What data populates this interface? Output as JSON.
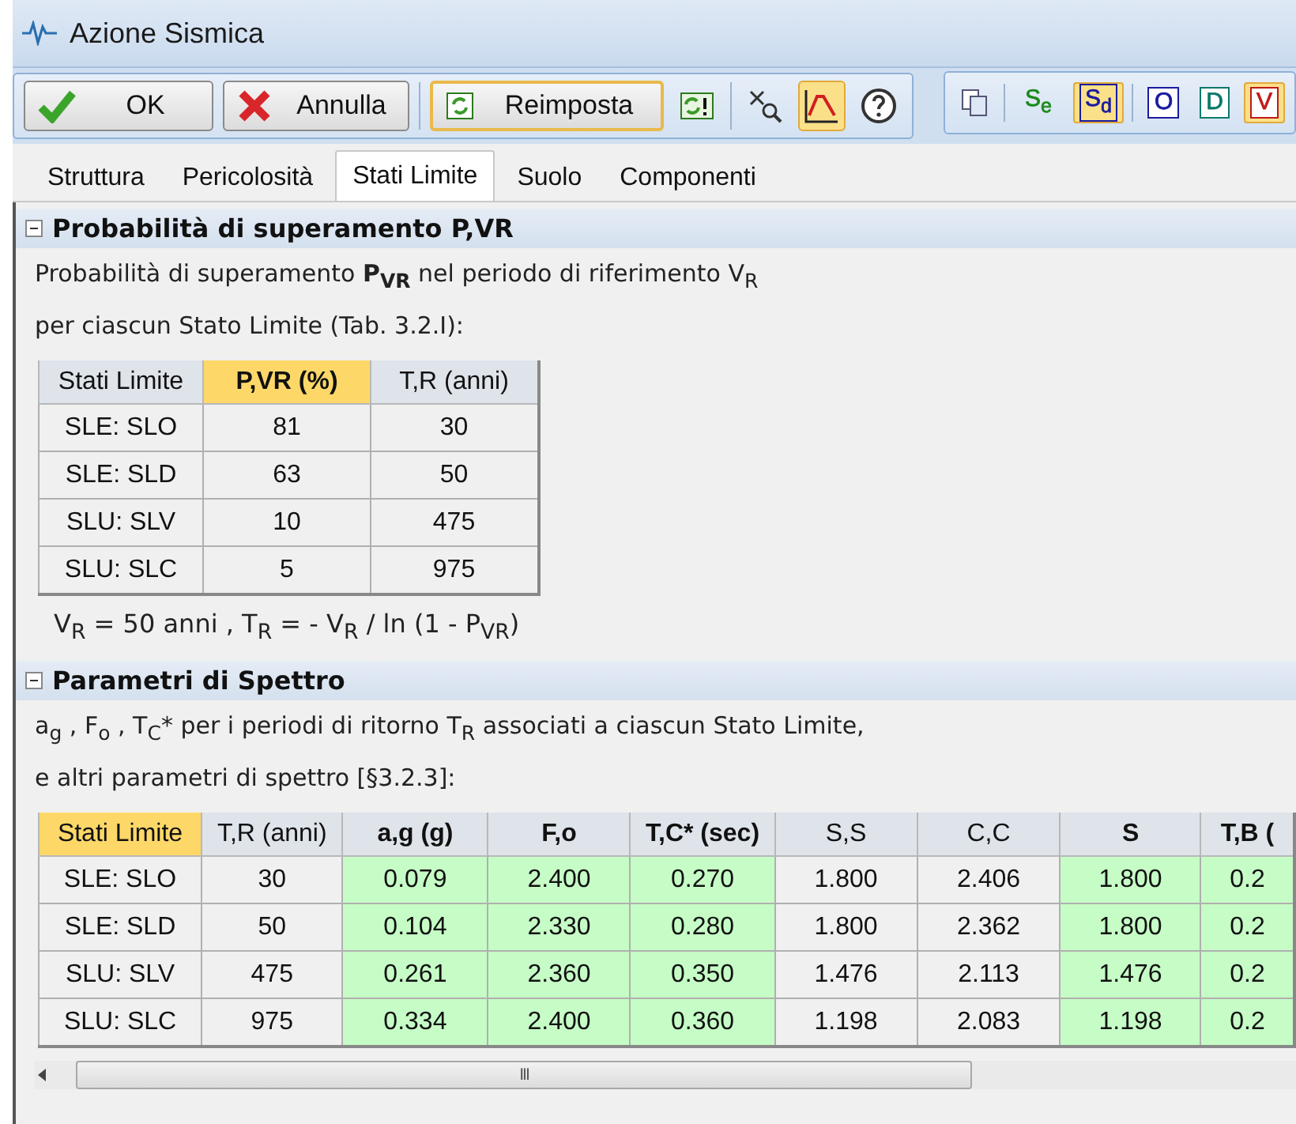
{
  "window": {
    "title": "Azione Sismica"
  },
  "toolbar": {
    "buttons": [
      {
        "kind": "ok",
        "label": "OK"
      },
      {
        "kind": "cancel",
        "label": "Annulla"
      },
      {
        "kind": "reset",
        "label": "Reimposta"
      }
    ],
    "tools": [
      {
        "kind": "refresh",
        "selected": false
      },
      {
        "kind": "zoom",
        "selected": false
      },
      {
        "kind": "chart",
        "selected": true
      },
      {
        "kind": "help",
        "selected": false
      }
    ],
    "toggles": [
      {
        "kind": "copy",
        "selected": false
      },
      {
        "kind": "letter",
        "label": "S$_{e}$",
        "selected": false,
        "color": "#1a8a1a"
      },
      {
        "kind": "letter",
        "label": "S$_{d}$",
        "selected": true,
        "color": "#1a1aa0"
      },
      {
        "kind": "letter",
        "label": "O",
        "selected": false,
        "color": "#1a1aa0"
      },
      {
        "kind": "letter",
        "label": "D",
        "selected": false,
        "color": "#0a7a6a"
      },
      {
        "kind": "letter",
        "label": "V",
        "selected": true,
        "color": "#c01818"
      }
    ]
  },
  "tabs": [
    {
      "label": "Struttura",
      "selected": false
    },
    {
      "label": "Pericolosità",
      "selected": false
    },
    {
      "label": "Stati Limite",
      "selected": true
    },
    {
      "label": "Suolo",
      "selected": false
    },
    {
      "label": "Componenti",
      "selected": false
    }
  ],
  "sections": [
    {
      "title": "Probabilità di superamento P,VR",
      "expanded": true,
      "text": [
        "Probabilità di superamento **P$_{VR}$** nel periodo di riferimento V$_{R}$",
        "per ciascun Stato Limite (Tab. 3.2.I):"
      ],
      "table": {
        "columns": [
          {
            "label": "Stati Limite",
            "selected": false,
            "bold": false,
            "computed": false
          },
          {
            "label": "P,VR (%)",
            "selected": true,
            "bold": true,
            "computed": false
          },
          {
            "label": "T,R (anni)",
            "selected": false,
            "bold": false,
            "computed": false
          }
        ],
        "rows": [
          [
            "SLE: SLO",
            "81",
            "30"
          ],
          [
            "SLE: SLD",
            "63",
            "50"
          ],
          [
            "SLU: SLV",
            "10",
            "475"
          ],
          [
            "SLU: SLC",
            "5",
            "975"
          ]
        ]
      },
      "note": "V$_{R}$ = 50 anni , T$_{R}$ = - V$_{R}$ / ln (1 - P$_{VR}$)"
    },
    {
      "title": "Parametri di Spettro",
      "expanded": true,
      "text": [
        "a$_{g}$ , F$_{o}$ , T$_{C}$* per i periodi di ritorno T$_{R}$ associati a ciascun Stato Limite,",
        "e altri parametri di spettro [§3.2.3]:"
      ],
      "table": {
        "columns": [
          {
            "label": "Stati Limite",
            "selected": true,
            "bold": false,
            "computed": false
          },
          {
            "label": "T,R (anni)",
            "selected": false,
            "bold": false,
            "computed": false
          },
          {
            "label": "a,g (g)",
            "selected": false,
            "bold": true,
            "computed": true
          },
          {
            "label": "F,o",
            "selected": false,
            "bold": true,
            "computed": true
          },
          {
            "label": "T,C* (sec)",
            "selected": false,
            "bold": true,
            "computed": true
          },
          {
            "label": "S,S",
            "selected": false,
            "bold": false,
            "computed": false
          },
          {
            "label": "C,C",
            "selected": false,
            "bold": false,
            "computed": false
          },
          {
            "label": "S",
            "selected": false,
            "bold": true,
            "computed": true
          },
          {
            "label": "T,B (",
            "selected": false,
            "bold": true,
            "computed": true
          }
        ],
        "rows": [
          [
            "SLE: SLO",
            "30",
            "0.079",
            "2.400",
            "0.270",
            "1.800",
            "2.406",
            "1.800",
            "0.2"
          ],
          [
            "SLE: SLD",
            "50",
            "0.104",
            "2.330",
            "0.280",
            "1.800",
            "2.362",
            "1.800",
            "0.2"
          ],
          [
            "SLU: SLV",
            "475",
            "0.261",
            "2.360",
            "0.350",
            "1.476",
            "2.113",
            "1.476",
            "0.2"
          ],
          [
            "SLU: SLC",
            "975",
            "0.334",
            "2.400",
            "0.360",
            "1.198",
            "2.083",
            "1.198",
            "0.2"
          ]
        ]
      },
      "scrollbar": "III"
    }
  ]
}
